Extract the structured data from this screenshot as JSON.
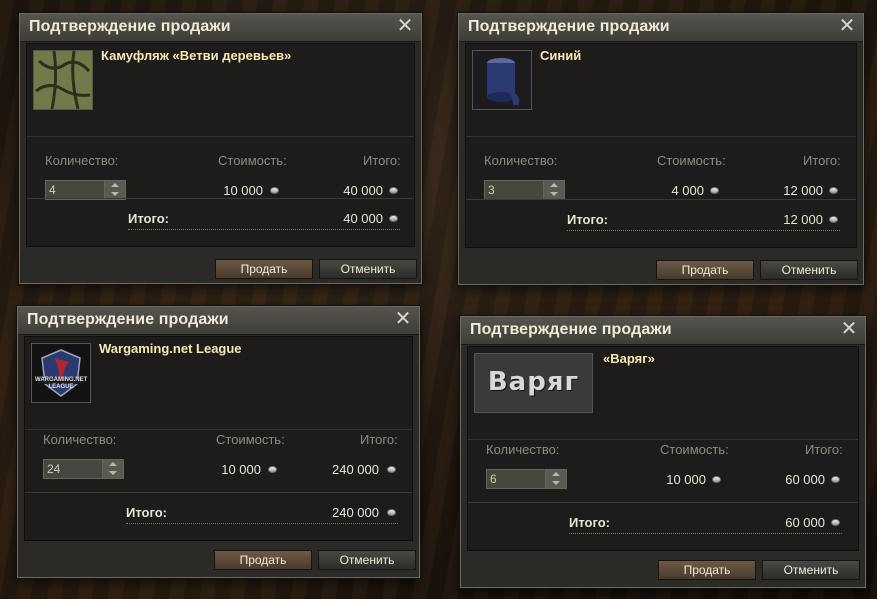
{
  "dialogs": [
    {
      "title": "Подтверждение продажи",
      "item_name": "Камуфляж «Ветви деревьев»",
      "thumbnail": "camouflage-branches-icon",
      "quantity_label": "Количество:",
      "quantity_value": "4",
      "cost_label": "Стоимость:",
      "cost_value": "10 000",
      "subtotal_label": "Итого:",
      "subtotal_value": "40 000",
      "total_label": "Итого:",
      "total_value": "40 000",
      "sell_label": "Продать",
      "cancel_label": "Отменить"
    },
    {
      "title": "Подтверждение продажи",
      "item_name": "Синий",
      "thumbnail": "blue-paint-can-icon",
      "quantity_label": "Количество:",
      "quantity_value": "3",
      "cost_label": "Стоимость:",
      "cost_value": "4 000",
      "subtotal_label": "Итого:",
      "subtotal_value": "12 000",
      "total_label": "Итого:",
      "total_value": "12 000",
      "sell_label": "Продать",
      "cancel_label": "Отменить"
    },
    {
      "title": "Подтверждение продажи",
      "item_name": "Wargaming.net League",
      "thumbnail": "wargaming-league-emblem-icon",
      "emblem_text_1": "WARGAMING.NET",
      "emblem_text_2": "LEAGUE",
      "quantity_label": "Количество:",
      "quantity_value": "24",
      "cost_label": "Стоимость:",
      "cost_value": "10 000",
      "subtotal_label": "Итого:",
      "subtotal_value": "240 000",
      "total_label": "Итого:",
      "total_value": "240 000",
      "sell_label": "Продать",
      "cancel_label": "Отменить"
    },
    {
      "title": "Подтверждение продажи",
      "item_name": "«Варяг»",
      "thumbnail": "varyag-inscription-icon",
      "inscription_text": "Варяг",
      "quantity_label": "Количество:",
      "quantity_value": "6",
      "cost_label": "Стоимость:",
      "cost_value": "10 000",
      "subtotal_label": "Итого:",
      "subtotal_value": "60 000",
      "total_label": "Итого:",
      "total_value": "60 000",
      "sell_label": "Продать",
      "cancel_label": "Отменить"
    }
  ],
  "colors": {
    "title_text": "#f0ead8",
    "item_name": "#f5e9b6",
    "label": "#8e8b80",
    "value": "#e8e4d8",
    "sell_button": "#5b4a3a"
  },
  "icons": {
    "close": "close-icon",
    "credits": "silver-coin-icon"
  }
}
